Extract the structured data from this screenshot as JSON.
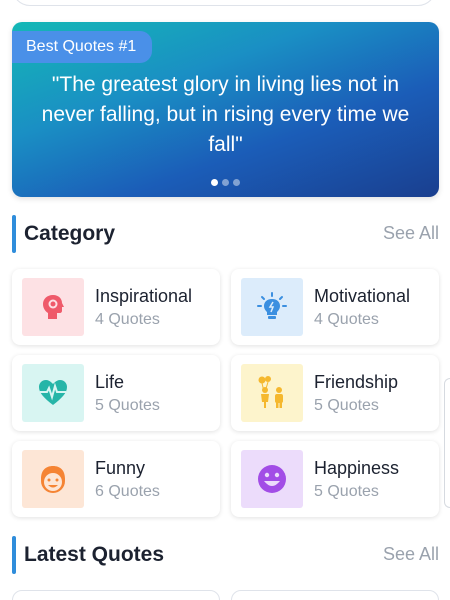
{
  "banner": {
    "badge": "Best Quotes #1",
    "quote": "\"The greatest glory in living lies not in never falling, but in rising every time we fall\"",
    "dots_count": 3,
    "active_dot": 0
  },
  "category_section": {
    "title": "Category",
    "see_all": "See All"
  },
  "categories": [
    {
      "name": "Inspirational",
      "count": "4 Quotes",
      "icon": "head-idea-icon",
      "bg": "#fde1e4"
    },
    {
      "name": "Motivational",
      "count": "4 Quotes",
      "icon": "lightbulb-icon",
      "bg": "#dcecfb"
    },
    {
      "name": "Life",
      "count": "5 Quotes",
      "icon": "heartbeat-icon",
      "bg": "#d8f5f2"
    },
    {
      "name": "Friendship",
      "count": "5 Quotes",
      "icon": "friends-balloons-icon",
      "bg": "#fdf4cc"
    },
    {
      "name": "Funny",
      "count": "6 Quotes",
      "icon": "funny-face-icon",
      "bg": "#fde6d6"
    },
    {
      "name": "Happiness",
      "count": "5 Quotes",
      "icon": "smiley-icon",
      "bg": "#ecdcfb"
    }
  ],
  "latest_section": {
    "title": "Latest Quotes",
    "see_all": "See All"
  },
  "colors": {
    "accent": "#2f8ddb",
    "muted_text": "#9aa2ad",
    "banner_badge": "#4a90e8"
  }
}
